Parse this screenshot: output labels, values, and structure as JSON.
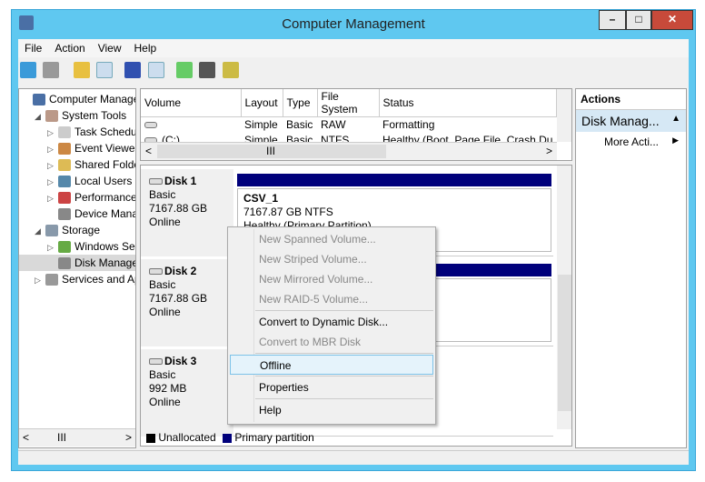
{
  "window": {
    "title": "Computer Management",
    "minimize": "–",
    "maximize": "□",
    "close": "✕"
  },
  "menu": [
    "File",
    "Action",
    "View",
    "Help"
  ],
  "tree": [
    {
      "label": "Computer Managemer",
      "indent": 0,
      "exp": ""
    },
    {
      "label": "System Tools",
      "indent": 1,
      "exp": "◢"
    },
    {
      "label": "Task Schedu",
      "indent": 2,
      "exp": "▷"
    },
    {
      "label": "Event Viewer",
      "indent": 2,
      "exp": "▷"
    },
    {
      "label": "Shared Folde",
      "indent": 2,
      "exp": "▷"
    },
    {
      "label": "Local Users a",
      "indent": 2,
      "exp": "▷"
    },
    {
      "label": "Performance",
      "indent": 2,
      "exp": "▷"
    },
    {
      "label": "Device Mana",
      "indent": 2,
      "exp": ""
    },
    {
      "label": "Storage",
      "indent": 1,
      "exp": "◢"
    },
    {
      "label": "Windows Se",
      "indent": 2,
      "exp": "▷"
    },
    {
      "label": "Disk Manage",
      "indent": 2,
      "exp": ""
    },
    {
      "label": "Services and Ap",
      "indent": 1,
      "exp": "▷"
    }
  ],
  "volumes": {
    "headers": [
      "Volume",
      "Layout",
      "Type",
      "File System",
      "Status"
    ],
    "rows": [
      [
        "",
        "Simple",
        "Basic",
        "RAW",
        "Formatting"
      ],
      [
        "(C:)",
        "Simple",
        "Basic",
        "NTFS",
        "Healthy (Boot, Page File, Crash Du"
      ]
    ]
  },
  "disks": [
    {
      "name": "Disk 1",
      "type": "Basic",
      "size": "7167.88 GB",
      "state": "Online",
      "vol_name": "CSV_1",
      "vol_size": "7167.87 GB NTFS",
      "vol_status": "Healthy (Primary Partition)"
    },
    {
      "name": "Disk 2",
      "type": "Basic",
      "size": "7167.88 GB",
      "state": "Online"
    },
    {
      "name": "Disk 3",
      "type": "Basic",
      "size": "992 MB",
      "state": "Online"
    }
  ],
  "legend": {
    "unallocated": "Unallocated",
    "primary": "Primary partition"
  },
  "actions": {
    "title": "Actions",
    "section": "Disk Manag...",
    "more": "More Acti..."
  },
  "context_menu": [
    {
      "label": "New Spanned Volume...",
      "disabled": true
    },
    {
      "label": "New Striped Volume...",
      "disabled": true
    },
    {
      "label": "New Mirrored Volume...",
      "disabled": true
    },
    {
      "label": "New RAID-5 Volume...",
      "disabled": true
    },
    {
      "sep": true
    },
    {
      "label": "Convert to Dynamic Disk...",
      "disabled": false
    },
    {
      "label": "Convert to MBR Disk",
      "disabled": true
    },
    {
      "sep": true
    },
    {
      "label": "Offline",
      "disabled": false,
      "highlight": true
    },
    {
      "sep": true
    },
    {
      "label": "Properties",
      "disabled": false
    },
    {
      "sep": true
    },
    {
      "label": "Help",
      "disabled": false
    }
  ],
  "colors": {
    "primary": "#00007b",
    "titlebar": "#5fc8f0"
  }
}
